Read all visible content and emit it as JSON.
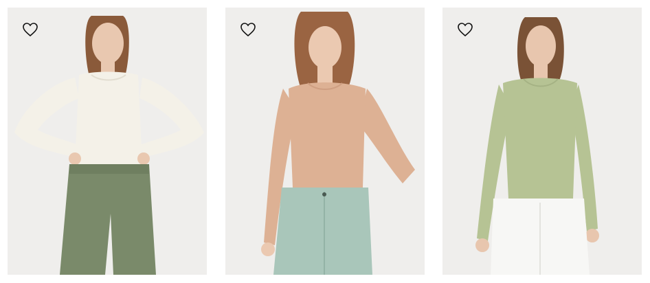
{
  "products": [
    {
      "favorite_icon": "heart-outline-icon",
      "top_color": "#f4f1e8",
      "bottom_color": "#7a8a6a",
      "skin_color": "#e9c8b0",
      "hair_color": "#8a5a3a"
    },
    {
      "favorite_icon": "heart-outline-icon",
      "top_color": "#ddb194",
      "bottom_color": "#a9c6ba",
      "skin_color": "#ebc9b1",
      "hair_color": "#9a6442"
    },
    {
      "favorite_icon": "heart-outline-icon",
      "top_color": "#b6c394",
      "bottom_color": "#f7f7f5",
      "skin_color": "#e8c6ae",
      "hair_color": "#7a5236"
    }
  ]
}
